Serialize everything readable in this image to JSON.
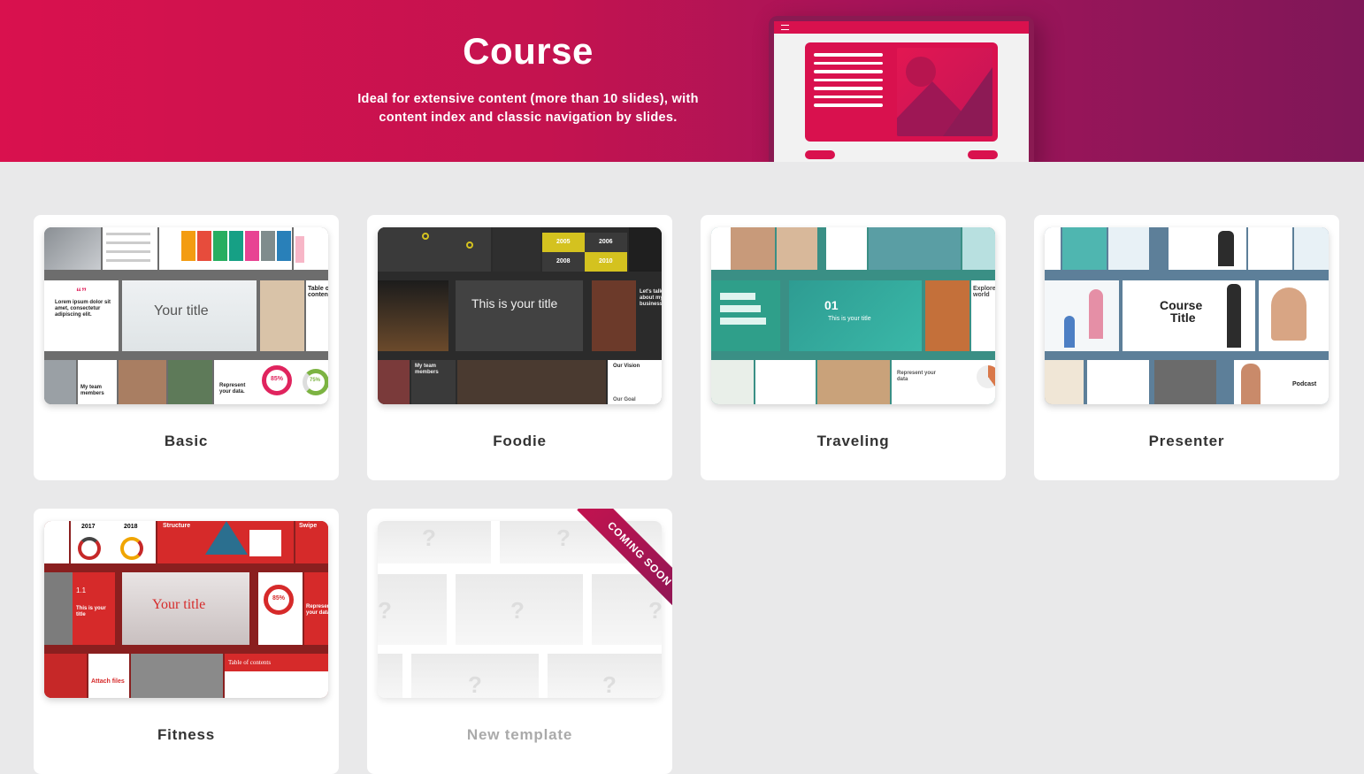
{
  "banner": {
    "title": "Course",
    "description_line1": "Ideal for extensive content (more than 10 slides), with",
    "description_line2": "content index and classic navigation by slides."
  },
  "templates": [
    {
      "label": "Basic",
      "thumb_text": {
        "title": "Your title",
        "toc": "Table of contents",
        "team": "My team members",
        "represent": "Represent your data.",
        "pct1": "85%",
        "pct2": "75%"
      }
    },
    {
      "label": "Foodie",
      "thumb_text": {
        "title": "This is your title",
        "y2005": "2005",
        "y2006": "2006",
        "y2008": "2008",
        "y2010": "2010",
        "team": "My team members",
        "vision": "Our Vision",
        "goal": "Our Goal",
        "talk": "Let's talk about my business"
      }
    },
    {
      "label": "Traveling",
      "thumb_text": {
        "num": "01",
        "title": "This is your title",
        "explore": "Explore the world",
        "represent": "Represent your data"
      }
    },
    {
      "label": "Presenter",
      "thumb_text": {
        "title_line1": "Course",
        "title_line2": "Title",
        "podcast": "Podcast"
      }
    },
    {
      "label": "Fitness",
      "thumb_text": {
        "y2017": "2017",
        "y2018": "2018",
        "structure": "Structure",
        "swipe": "Swipe",
        "title": "Your title",
        "num": "1.1",
        "subtitle": "This is your title",
        "pct": "85%",
        "represent": "Represent your data",
        "toc": "Table of contents",
        "attach": "Attach files"
      }
    },
    {
      "label": "New template",
      "ribbon": "COMING SOON",
      "placeholder_glyph": "?"
    }
  ],
  "colors": {
    "accent": "#d9114e",
    "accent_dark": "#7f1758",
    "background": "#e9e9ea"
  }
}
